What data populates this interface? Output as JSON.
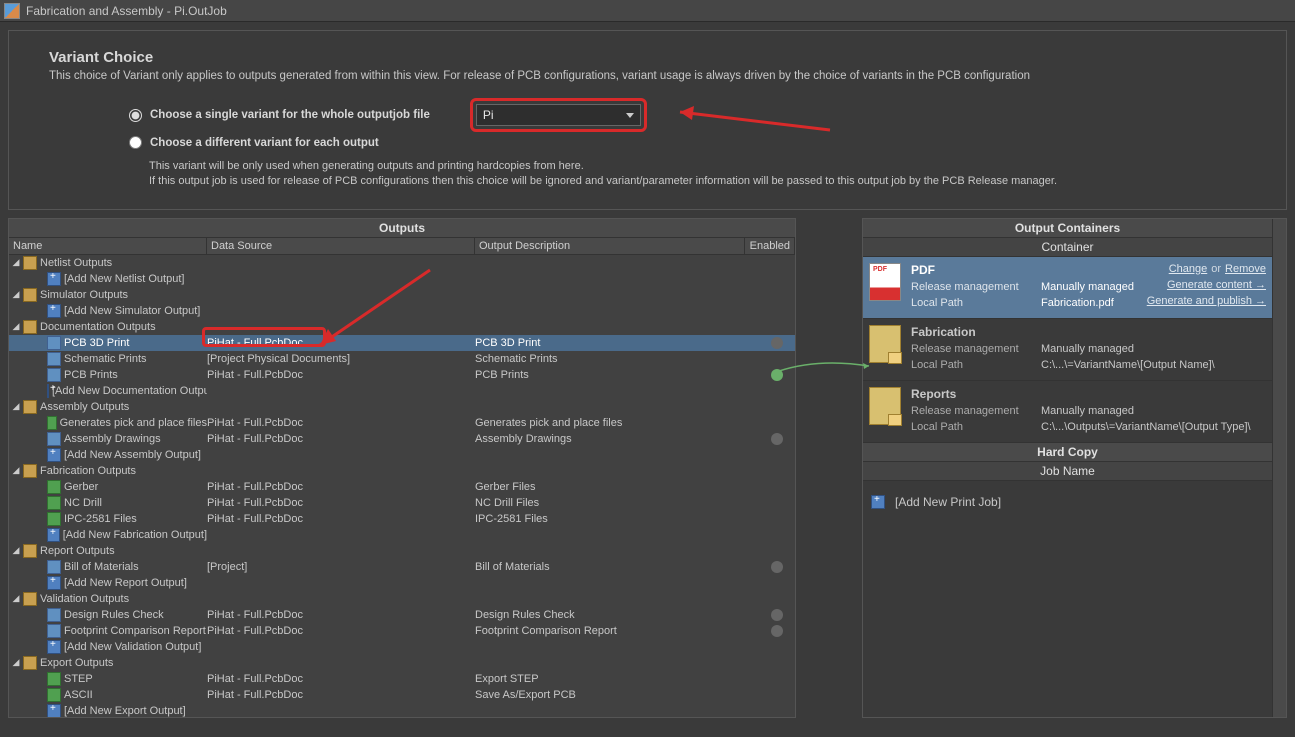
{
  "window": {
    "title": "Fabrication and Assembly - Pi.OutJob"
  },
  "variant": {
    "heading": "Variant Choice",
    "desc": "This choice of Variant only applies to outputs generated from within this view. For release of PCB configurations, variant usage is always driven by the choice of variants in the PCB configuration",
    "radio_single": "Choose a single variant for the whole outputjob file",
    "radio_each": "Choose a different variant for each output",
    "selected": "Pi",
    "note1": "This variant will be only used when generating outputs and printing hardcopies from here.",
    "note2": "If this output job is used for release of PCB configurations then this choice will be ignored and variant/parameter information will be passed to this output job by the PCB Release manager."
  },
  "outputs": {
    "panel_title": "Outputs",
    "cols": {
      "name": "Name",
      "src": "Data Source",
      "desc": "Output Description",
      "enabled": "Enabled"
    },
    "groups": [
      {
        "label": "Netlist Outputs",
        "add": "[Add New Netlist Output]",
        "items": []
      },
      {
        "label": "Simulator Outputs",
        "add": "[Add New Simulator Output]",
        "items": []
      },
      {
        "label": "Documentation Outputs",
        "add": "[Add New Documentation Output]",
        "items": [
          {
            "name": "PCB 3D Print",
            "src": "PiHat - Full.PcbDoc",
            "desc": "PCB 3D Print",
            "selected": true,
            "enabled": "off"
          },
          {
            "name": "Schematic Prints",
            "src": "[Project Physical Documents]",
            "desc": "Schematic Prints"
          },
          {
            "name": "PCB Prints",
            "src": "PiHat - Full.PcbDoc",
            "desc": "PCB Prints",
            "enabled": "on"
          }
        ]
      },
      {
        "label": "Assembly Outputs",
        "add": "[Add New Assembly Output]",
        "items": [
          {
            "name": "Generates pick and place files",
            "src": "PiHat - Full.PcbDoc",
            "desc": "Generates pick and place files",
            "icon": "green"
          },
          {
            "name": "Assembly Drawings",
            "src": "PiHat - Full.PcbDoc",
            "desc": "Assembly Drawings",
            "enabled": "off"
          }
        ]
      },
      {
        "label": "Fabrication Outputs",
        "add": "[Add New Fabrication Output]",
        "items": [
          {
            "name": "Gerber",
            "src": "PiHat - Full.PcbDoc",
            "desc": "Gerber Files",
            "icon": "green"
          },
          {
            "name": "NC Drill",
            "src": "PiHat - Full.PcbDoc",
            "desc": "NC Drill Files",
            "icon": "green"
          },
          {
            "name": "IPC-2581 Files",
            "src": "PiHat - Full.PcbDoc",
            "desc": "IPC-2581 Files",
            "icon": "green"
          }
        ]
      },
      {
        "label": "Report Outputs",
        "add": "[Add New Report Output]",
        "items": [
          {
            "name": "Bill of Materials",
            "src": "[Project]",
            "desc": "Bill of Materials",
            "enabled": "off"
          }
        ]
      },
      {
        "label": "Validation Outputs",
        "add": "[Add New Validation Output]",
        "items": [
          {
            "name": "Design Rules Check",
            "src": "PiHat - Full.PcbDoc",
            "desc": "Design Rules Check",
            "enabled": "off"
          },
          {
            "name": "Footprint Comparison Report",
            "src": "PiHat - Full.PcbDoc",
            "desc": "Footprint Comparison Report",
            "enabled": "off"
          }
        ]
      },
      {
        "label": "Export Outputs",
        "add": "[Add New Export Output]",
        "items": [
          {
            "name": "STEP",
            "src": "PiHat - Full.PcbDoc",
            "desc": "Export STEP",
            "icon": "green"
          },
          {
            "name": "ASCII",
            "src": "PiHat - Full.PcbDoc",
            "desc": "Save As/Export PCB",
            "icon": "green"
          }
        ]
      }
    ]
  },
  "containers": {
    "panel_title": "Output Containers",
    "subtitle": "Container",
    "actions": {
      "change": "Change",
      "or": "or",
      "remove": "Remove",
      "gen_content": "Generate content →",
      "gen_publish": "Generate and publish →"
    },
    "items": [
      {
        "title": "PDF",
        "type": "pdf",
        "rm": "Manually managed",
        "lp": "Fabrication.pdf",
        "show_actions": true
      },
      {
        "title": "Fabrication",
        "type": "folder",
        "rm": "Manually managed",
        "lp": "C:\\...\\=VariantName\\[Output Name]\\"
      },
      {
        "title": "Reports",
        "type": "folder",
        "rm": "Manually managed",
        "lp": "C:\\...\\Outputs\\=VariantName\\[Output Type]\\"
      }
    ],
    "hardcopy_title": "Hard Copy",
    "hardcopy_sub": "Job Name",
    "add_print": "[Add New Print Job]",
    "kv_rm": "Release management",
    "kv_lp": "Local Path"
  }
}
